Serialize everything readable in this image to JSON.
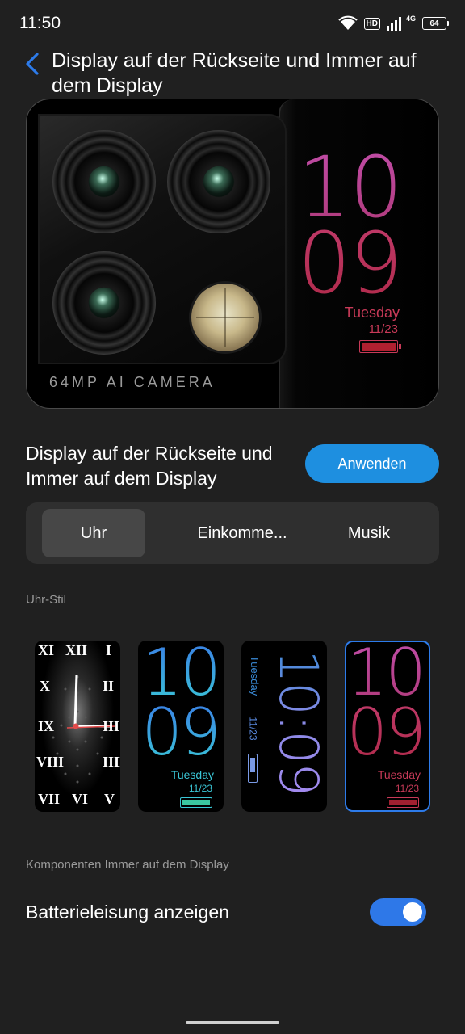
{
  "status_bar": {
    "time": "11:50",
    "hd": "HD",
    "network": "4G",
    "battery": "64"
  },
  "header": {
    "title": "Display auf der Rückseite und Immer auf dem Display"
  },
  "preview": {
    "camera_label": "64MP AI CAMERA",
    "clock_hour": "10",
    "clock_minute": "09",
    "day": "Tuesday",
    "date": "11/23"
  },
  "apply": {
    "text": "Display auf der Rückseite und Immer auf dem Display",
    "button_label": "Anwenden"
  },
  "tabs": [
    {
      "label": "Uhr",
      "active": true
    },
    {
      "label": "Einkomme...",
      "active": false
    },
    {
      "label": "Musik",
      "active": false
    }
  ],
  "clock_style_label": "Uhr-Stil",
  "clock_styles": [
    {
      "name": "roman"
    },
    {
      "name": "digital-blue",
      "hour": "10",
      "minute": "09",
      "day": "Tuesday",
      "date": "11/23"
    },
    {
      "name": "digital-rotated",
      "time": "10:09",
      "day": "Tuesday",
      "date": "11/23"
    },
    {
      "name": "digital-pink",
      "hour": "10",
      "minute": "09",
      "day": "Tuesday",
      "date": "11/23",
      "selected": true
    }
  ],
  "roman_numerals": [
    "XII",
    "I",
    "II",
    "III",
    "IIII",
    "V",
    "VI",
    "VII",
    "VIII",
    "IX",
    "X",
    "XI"
  ],
  "components_label": "Komponenten Immer auf dem Display",
  "battery_toggle": {
    "label": "Batterieleisung anzeigen",
    "on": true
  },
  "colors": {
    "accent": "#1e8fe0",
    "toggle": "#2e78e8",
    "pink": "#c83a58"
  }
}
